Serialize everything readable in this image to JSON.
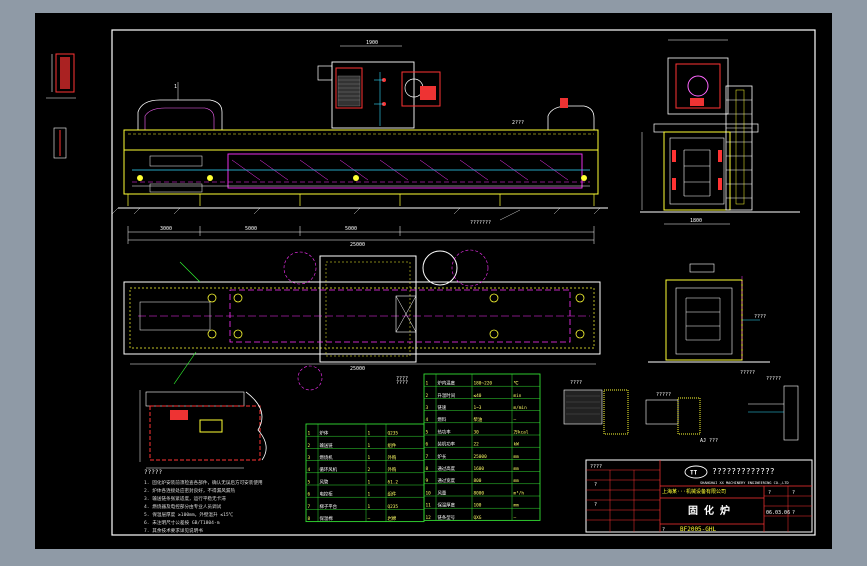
{
  "title_block": {
    "company_line": "?????????????",
    "company_cn": "上海某···机械设备有限公司",
    "company_en": "SHANGHAI XX MACHINERY ENGINEERING CO.,LTD",
    "drawing_title": "固 化 炉",
    "drawing_no": "BF2005-GHL",
    "date": "06.03.06",
    "marks": [
      "????",
      "?",
      "?",
      "?",
      "?"
    ],
    "misc": "?",
    "scale_cell": "?"
  },
  "notes": {
    "heading": "?????",
    "lines": [
      "1. 固化炉安装前须检查各部件，确认无误后方可安装使用",
      "2. 炉体各连接处应密封良好，不得漏风漏热",
      "3. 输送链条张紧适度，运行平稳无卡滞",
      "4. 燃烧器及电控部分由专业人员调试",
      "5. 保温层厚度 ≥100mm，外壁温升 ≤15℃",
      "6. 未注明尺寸公差按 GB/T1804-m",
      "7. 其余技术要求详见说明书"
    ]
  },
  "tables": {
    "green_left": {
      "rows": [
        [
          "1",
          "炉体",
          "1",
          "Q235"
        ],
        [
          "2",
          "输送链",
          "1",
          "组件"
        ],
        [
          "3",
          "燃烧机",
          "1",
          "外购"
        ],
        [
          "4",
          "循环风机",
          "2",
          "外购"
        ],
        [
          "5",
          "风管",
          "1",
          "δ1.2"
        ],
        [
          "6",
          "电控柜",
          "1",
          "组件"
        ],
        [
          "7",
          "梯子平台",
          "1",
          "Q235"
        ],
        [
          "8",
          "保温棉",
          "—",
          "岩棉"
        ]
      ]
    },
    "green_right": {
      "rows": [
        [
          "1",
          "炉内温度",
          "180~220",
          "℃"
        ],
        [
          "2",
          "升温时间",
          "≤40",
          "min"
        ],
        [
          "3",
          "链速",
          "1~3",
          "m/min"
        ],
        [
          "4",
          "燃料",
          "柴油",
          "—"
        ],
        [
          "5",
          "热功率",
          "30",
          "万kcal"
        ],
        [
          "6",
          "装机功率",
          "22",
          "kW"
        ],
        [
          "7",
          "炉长",
          "25000",
          "mm"
        ],
        [
          "8",
          "通过高度",
          "1600",
          "mm"
        ],
        [
          "9",
          "通过宽度",
          "800",
          "mm"
        ],
        [
          "10",
          "风量",
          "8000",
          "m³/h"
        ],
        [
          "11",
          "保温厚度",
          "100",
          "mm"
        ],
        [
          "12",
          "链条型号",
          "QXG",
          "—"
        ]
      ]
    }
  },
  "labels": {
    "detail_tag": "????",
    "section_a": "?????",
    "section_b": "????"
  },
  "colors": {
    "background_gray": "#8f9aa6",
    "canvas_black": "#000000",
    "frame_white": "#ffffff",
    "yellow": "#ffff33",
    "magenta": "#ff33ff",
    "green": "#33dd33",
    "red": "#ff3333",
    "cyan": "#33ffff"
  }
}
